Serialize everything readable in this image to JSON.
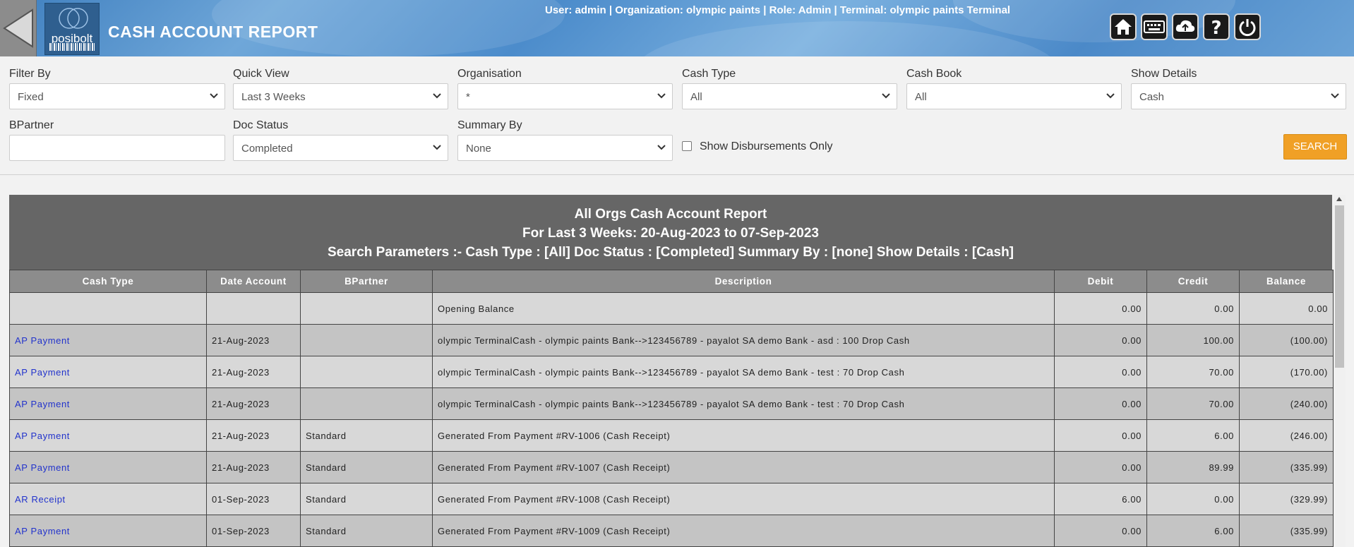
{
  "header": {
    "title": "CASH ACCOUNT REPORT",
    "user_info": "User: admin | Organization: olympic paints | Role: Admin | Terminal: olympic paints Terminal",
    "logo_text": "posibolt"
  },
  "filters": {
    "filter_by": {
      "label": "Filter By",
      "value": "Fixed"
    },
    "quick_view": {
      "label": "Quick View",
      "value": "Last 3 Weeks"
    },
    "organisation": {
      "label": "Organisation",
      "value": "*"
    },
    "cash_type": {
      "label": "Cash Type",
      "value": "All"
    },
    "cash_book": {
      "label": "Cash Book",
      "value": "All"
    },
    "show_details": {
      "label": "Show Details",
      "value": "Cash"
    },
    "bpartner": {
      "label": "BPartner",
      "value": ""
    },
    "doc_status": {
      "label": "Doc Status",
      "value": "Completed"
    },
    "summary_by": {
      "label": "Summary By",
      "value": "None"
    },
    "disbursements": {
      "label": "Show Disbursements Only",
      "checked": false
    },
    "search_label": "SEARCH"
  },
  "report": {
    "title": "All Orgs Cash Account Report",
    "period": "For Last 3 Weeks: 20-Aug-2023 to 07-Sep-2023",
    "params": "Search Parameters :- Cash Type : [All] Doc Status : [Completed] Summary By : [none] Show Details : [Cash]",
    "columns": [
      "Cash Type",
      "Date Account",
      "BPartner",
      "Description",
      "Debit",
      "Credit",
      "Balance"
    ],
    "rows": [
      {
        "cash_type": "",
        "date": "",
        "bpartner": "",
        "description": "Opening Balance",
        "debit": "0.00",
        "credit": "0.00",
        "balance": "0.00"
      },
      {
        "cash_type": "AP Payment",
        "date": "21-Aug-2023",
        "bpartner": "",
        "description": "olympic TerminalCash - olympic paints Bank-->123456789 - payalot SA demo Bank - asd : 100 Drop Cash",
        "debit": "0.00",
        "credit": "100.00",
        "balance": "(100.00)"
      },
      {
        "cash_type": "AP Payment",
        "date": "21-Aug-2023",
        "bpartner": "",
        "description": "olympic TerminalCash - olympic paints Bank-->123456789 - payalot SA demo Bank - test : 70 Drop Cash",
        "debit": "0.00",
        "credit": "70.00",
        "balance": "(170.00)"
      },
      {
        "cash_type": "AP Payment",
        "date": "21-Aug-2023",
        "bpartner": "",
        "description": "olympic TerminalCash - olympic paints Bank-->123456789 - payalot SA demo Bank - test : 70 Drop Cash",
        "debit": "0.00",
        "credit": "70.00",
        "balance": "(240.00)"
      },
      {
        "cash_type": "AP Payment",
        "date": "21-Aug-2023",
        "bpartner": "Standard",
        "description": "Generated From Payment #RV-1006 (Cash Receipt)",
        "debit": "0.00",
        "credit": "6.00",
        "balance": "(246.00)"
      },
      {
        "cash_type": "AP Payment",
        "date": "21-Aug-2023",
        "bpartner": "Standard",
        "description": "Generated From Payment #RV-1007 (Cash Receipt)",
        "debit": "0.00",
        "credit": "89.99",
        "balance": "(335.99)"
      },
      {
        "cash_type": "AR Receipt",
        "date": "01-Sep-2023",
        "bpartner": "Standard",
        "description": "Generated From Payment #RV-1008 (Cash Receipt)",
        "debit": "6.00",
        "credit": "0.00",
        "balance": "(329.99)"
      },
      {
        "cash_type": "AP Payment",
        "date": "01-Sep-2023",
        "bpartner": "Standard",
        "description": "Generated From Payment #RV-1009 (Cash Receipt)",
        "debit": "0.00",
        "credit": "6.00",
        "balance": "(335.99)"
      }
    ]
  },
  "header_icons": [
    "home-icon",
    "keyboard-icon",
    "cloud-sync-icon",
    "help-icon",
    "power-icon"
  ],
  "colors": {
    "accent": "#f0a026",
    "link": "#2233cc",
    "report_header": "#666666"
  }
}
